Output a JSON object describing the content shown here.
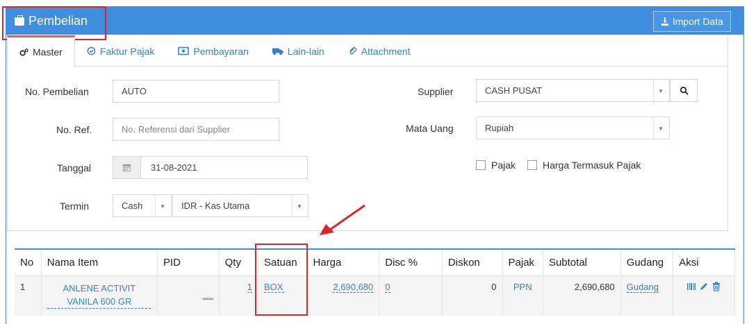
{
  "header": {
    "title": "Pembelian",
    "import_label": "Import Data"
  },
  "tabs": [
    {
      "label": "Master",
      "icon": "gears-icon",
      "active": true
    },
    {
      "label": "Faktur Pajak",
      "icon": "check-circle-icon"
    },
    {
      "label": "Pembayaran",
      "icon": "money-icon"
    },
    {
      "label": "Lain-lain",
      "icon": "truck-icon"
    },
    {
      "label": "Attachment",
      "icon": "paperclip-icon"
    }
  ],
  "form": {
    "no_pembelian_label": "No. Pembelian",
    "no_pembelian_value": "AUTO",
    "no_ref_label": "No. Ref.",
    "no_ref_placeholder": "No. Referensi dari Supplier",
    "tanggal_label": "Tanggal",
    "tanggal_value": "31-08-2021",
    "termin_label": "Termin",
    "termin_value": "Cash",
    "kas_value": "IDR - Kas Utama",
    "supplier_label": "Supplier",
    "supplier_value": "CASH PUSAT",
    "mata_uang_label": "Mata Uang",
    "mata_uang_value": "Rupiah",
    "pajak_label": "Pajak",
    "harga_termasuk_pajak_label": "Harga Termasuk Pajak"
  },
  "table": {
    "columns": [
      "No",
      "Nama Item",
      "PID",
      "Qty",
      "Satuan",
      "Harga",
      "Disc %",
      "Diskon",
      "Pajak",
      "Subtotal",
      "Gudang",
      "Aksi"
    ],
    "rows": [
      {
        "no": "1",
        "nama_line1": "ANLENE ACTIVIT",
        "nama_line2": "VANILA 600 GR",
        "pid": "__",
        "qty": "1",
        "satuan": "BOX",
        "harga": "2,690,680",
        "disc": "0",
        "diskon": "0",
        "pajak": "PPN",
        "subtotal": "2,690,680",
        "gudang": "Gudang"
      }
    ]
  },
  "colors": {
    "primary": "#3f8ee0",
    "highlight": "#d9262b",
    "link": "#3a82c4"
  }
}
